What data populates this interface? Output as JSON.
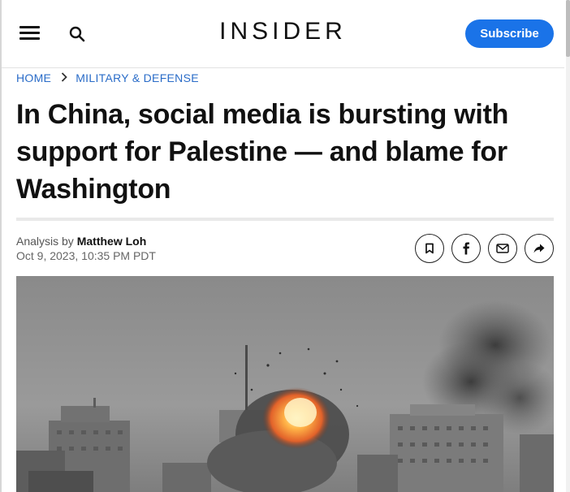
{
  "header": {
    "logo": "INSIDER",
    "subscribe_label": "Subscribe",
    "icons": [
      "hamburger-menu-icon",
      "search-icon"
    ]
  },
  "breadcrumb": {
    "home": "HOME",
    "section": "MILITARY & DEFENSE"
  },
  "article": {
    "title": "In China, social media is bursting with support for Palestine — and blame for Washington",
    "byline_prefix": "Analysis by",
    "author": "Matthew Loh",
    "date": "Oct 9, 2023, 10:35 PM PDT"
  },
  "share_icons": [
    "bookmark-icon",
    "facebook-icon",
    "email-icon",
    "share-arrow-icon"
  ],
  "colors": {
    "accent": "#1a73e8",
    "breadcrumb_link": "#2a6cc8",
    "text": "#111111"
  }
}
